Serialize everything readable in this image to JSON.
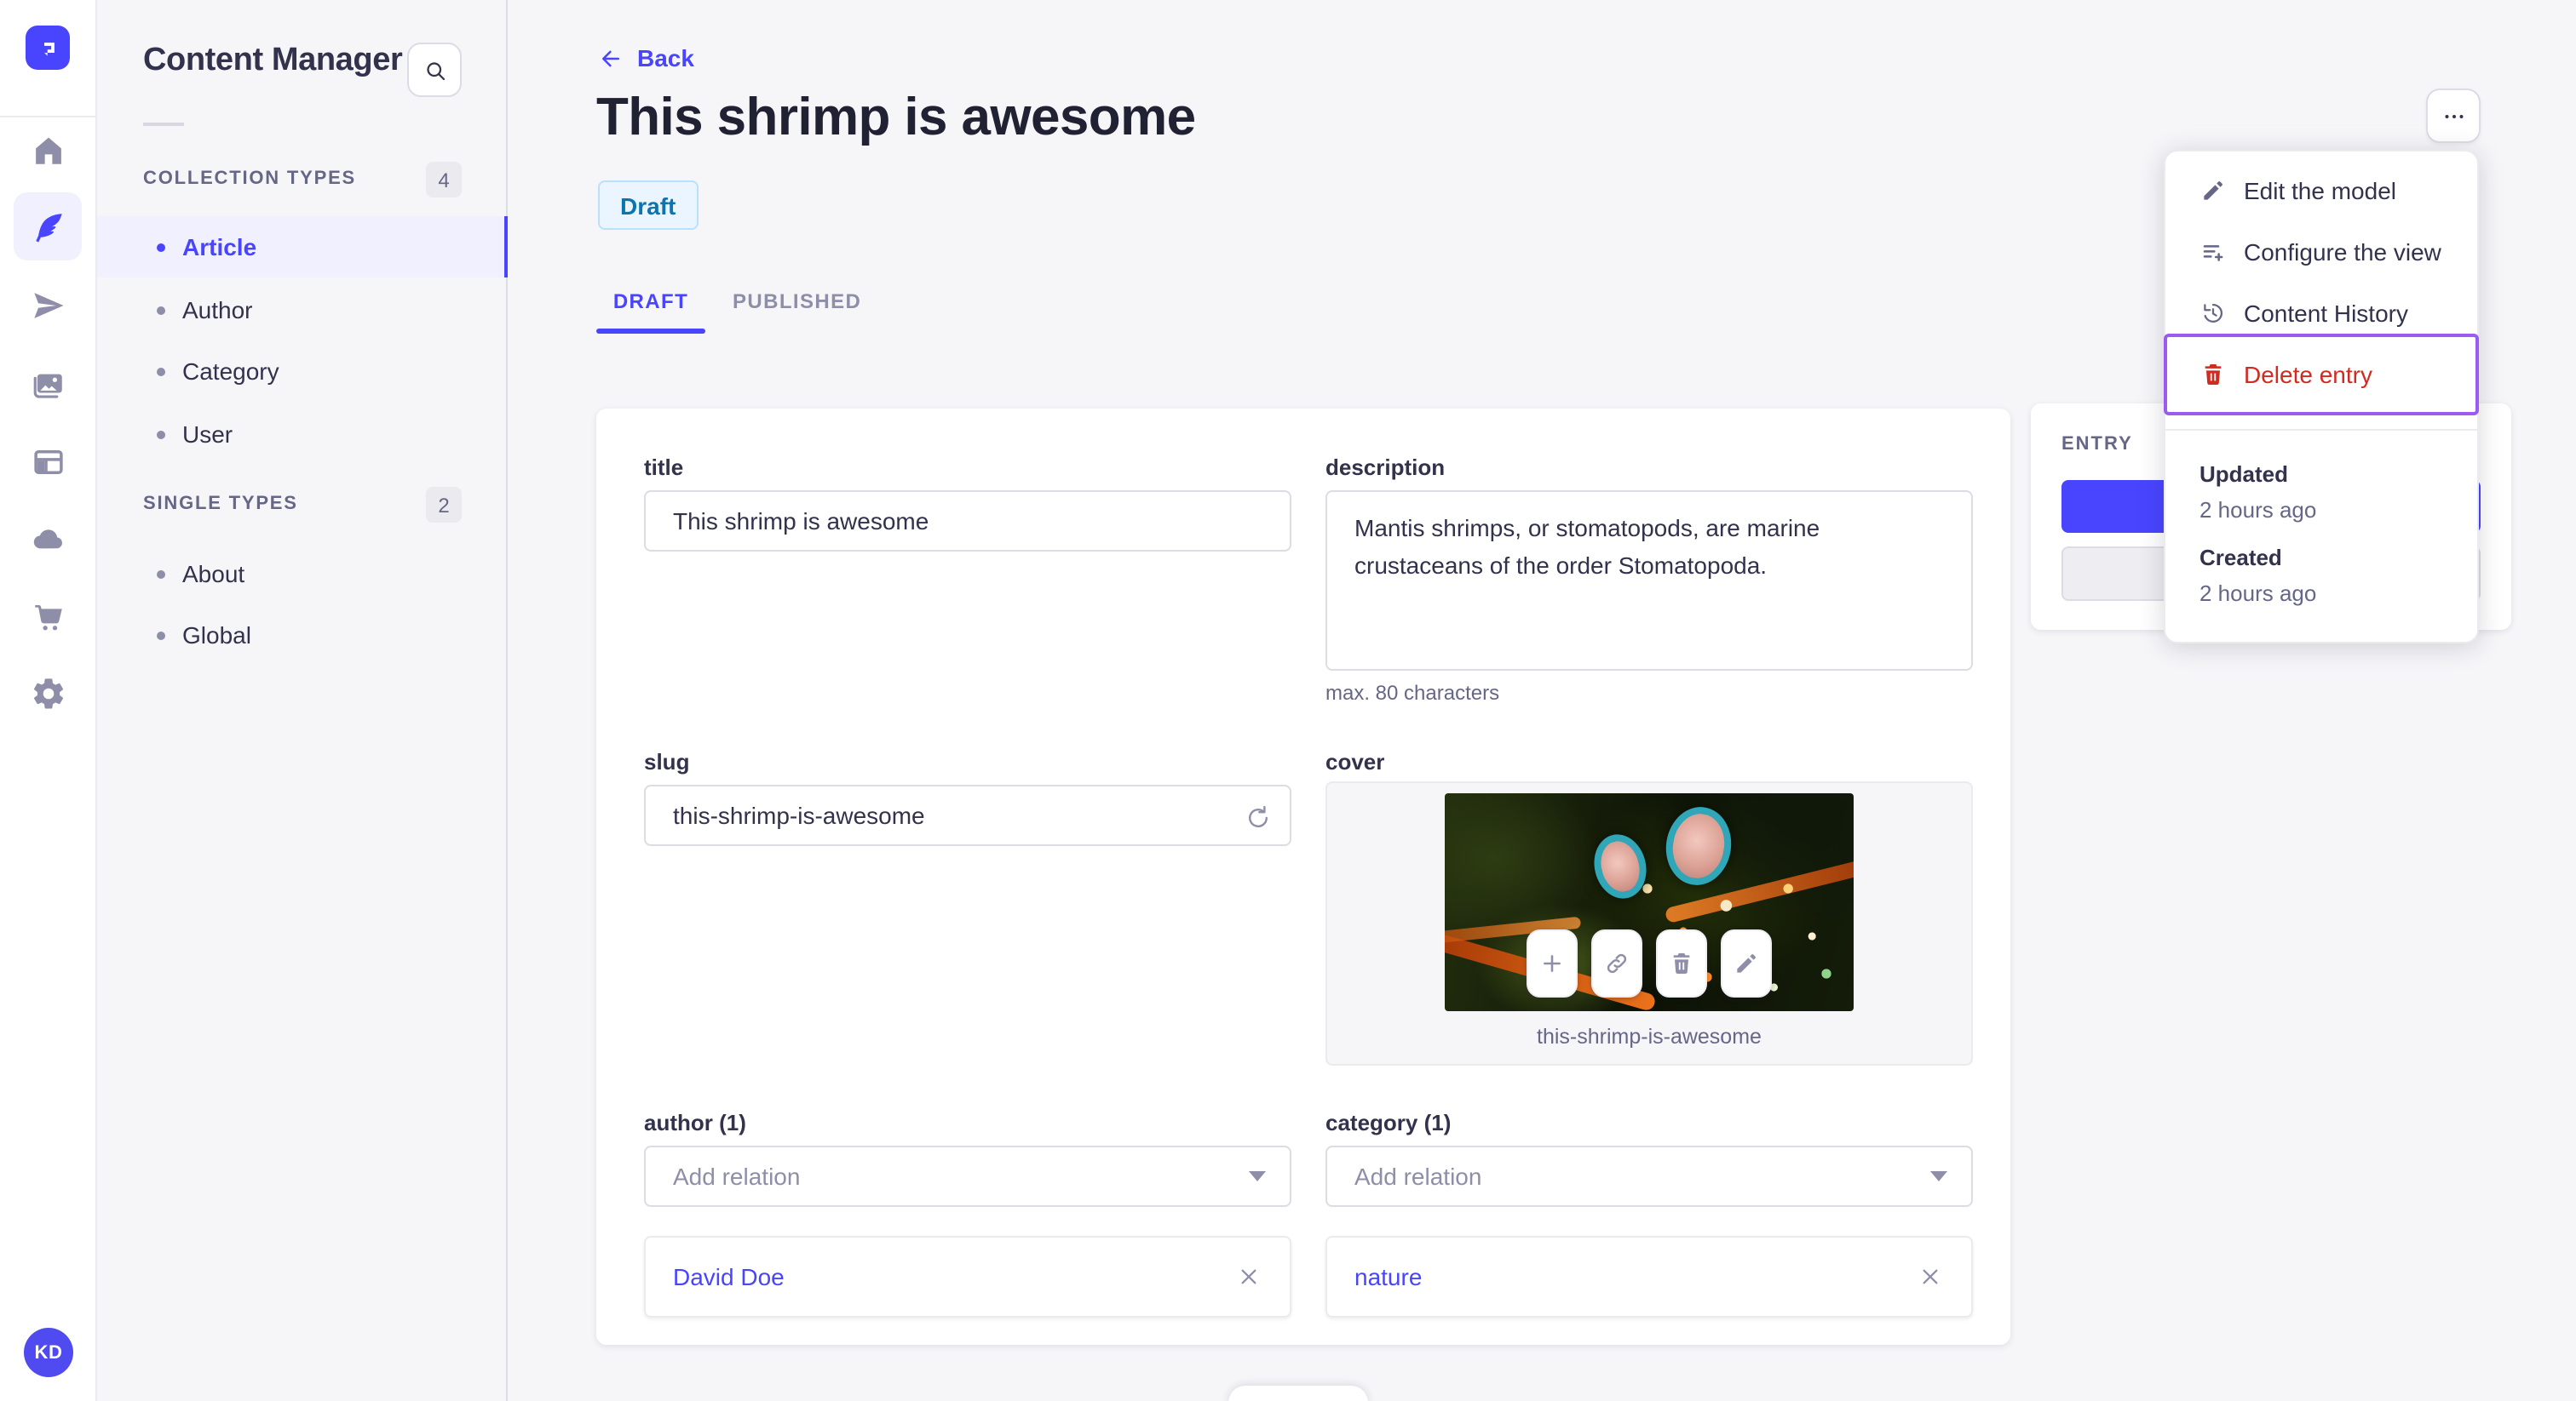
{
  "colors": {
    "accent": "#4945ff",
    "accent_bg": "#f0f0ff",
    "page_bg": "#f6f6f9",
    "border": "#dcdce4",
    "text_primary": "#32324d",
    "text_secondary": "#666687",
    "danger": "#d02b20",
    "draft_badge_bg": "#eaf5ff",
    "draft_badge_border": "#b8e1ff",
    "draft_badge_text": "#0c75af",
    "delete_highlight_border": "#9b5bef"
  },
  "rail": {
    "logo_icon": "strapi-logo",
    "icons": [
      "home-icon",
      "feather-icon",
      "paper-plane-icon",
      "media-icon",
      "layout-icon",
      "cloud-icon",
      "cart-icon",
      "gear-icon"
    ],
    "active_icon": "feather-icon",
    "avatar": "KD"
  },
  "subnav": {
    "title": "Content Manager",
    "search_icon": "search-icon",
    "collection": {
      "label": "COLLECTION TYPES",
      "count": "4",
      "items": [
        {
          "label": "Article",
          "active": true
        },
        {
          "label": "Author"
        },
        {
          "label": "Category"
        },
        {
          "label": "User"
        }
      ]
    },
    "single": {
      "label": "SINGLE TYPES",
      "count": "2",
      "items": [
        {
          "label": "About"
        },
        {
          "label": "Global"
        }
      ]
    }
  },
  "header": {
    "back": "Back",
    "title": "This shrimp is awesome",
    "status": "Draft",
    "tabs": [
      {
        "label": "DRAFT",
        "active": true
      },
      {
        "label": "PUBLISHED"
      }
    ]
  },
  "form": {
    "title": {
      "label": "title",
      "value": "This shrimp is awesome"
    },
    "description": {
      "label": "description",
      "value": "Mantis shrimps, or stomatopods, are marine crustaceans of the order Stomatopoda.",
      "hint": "max. 80 characters"
    },
    "slug": {
      "label": "slug",
      "value": "this-shrimp-is-awesome",
      "icon": "regenerate-icon"
    },
    "cover": {
      "label": "cover",
      "filename": "this-shrimp-is-awesome",
      "image_alt": "mantis shrimp photo",
      "actions": [
        "add-icon",
        "link-icon",
        "trash-icon",
        "edit-icon"
      ]
    },
    "author": {
      "label": "author (1)",
      "placeholder": "Add relation",
      "relation": "David Doe"
    },
    "category": {
      "label": "category (1)",
      "placeholder": "Add relation",
      "relation": "nature"
    }
  },
  "entry_panel": {
    "title": "ENTRY"
  },
  "menu": {
    "more_icon": "ellipsis-icon",
    "items": [
      {
        "icon": "pencil-icon",
        "label": "Edit the model"
      },
      {
        "icon": "configure-icon",
        "label": "Configure the view"
      },
      {
        "icon": "history-icon",
        "label": "Content History"
      },
      {
        "icon": "trash-icon",
        "label": "Delete entry",
        "danger": true,
        "highlighted": true
      }
    ],
    "meta": [
      {
        "label": "Updated",
        "value": "2 hours ago"
      },
      {
        "label": "Created",
        "value": "2 hours ago"
      }
    ]
  }
}
